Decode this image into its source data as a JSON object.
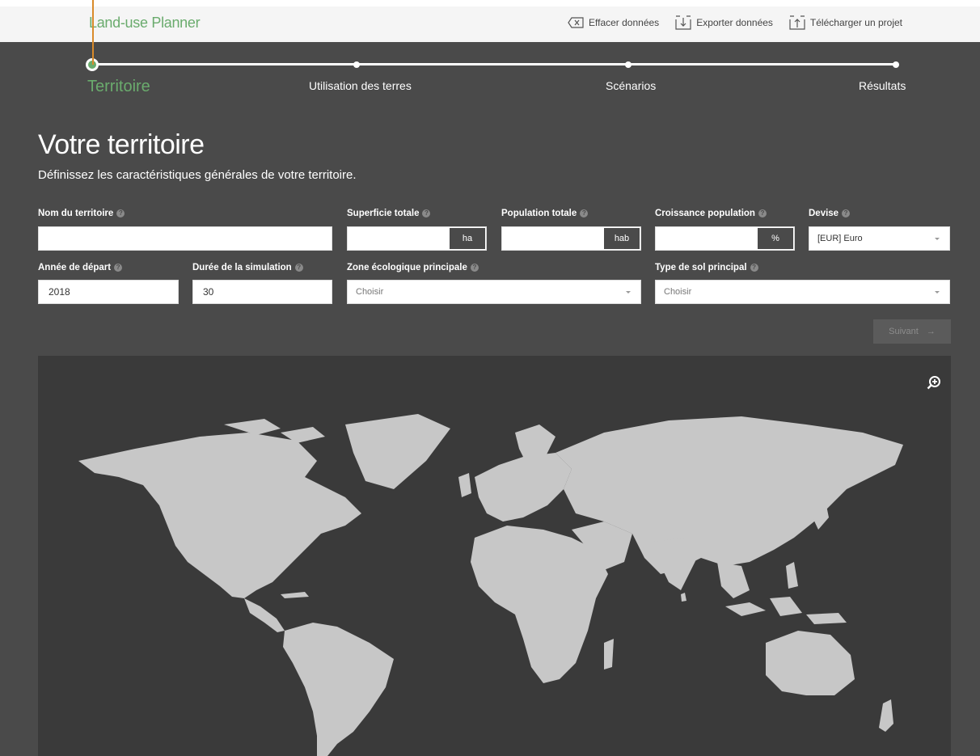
{
  "app": {
    "title": "Land-use Planner"
  },
  "toolbar": {
    "clear_label": "Effacer données",
    "export_label": "Exporter données",
    "upload_label": "Télécharger un projet"
  },
  "stepper": {
    "steps": [
      {
        "label": "Territoire",
        "active": true
      },
      {
        "label": "Utilisation des terres",
        "active": false
      },
      {
        "label": "Scénarios",
        "active": false
      },
      {
        "label": "Résultats",
        "active": false
      }
    ]
  },
  "page": {
    "title": "Votre territoire",
    "subtitle": "Définissez les caractéristiques générales de votre territoire."
  },
  "form": {
    "name": {
      "label": "Nom du territoire",
      "value": ""
    },
    "area": {
      "label": "Superficie totale",
      "value": "",
      "unit": "ha"
    },
    "population": {
      "label": "Population totale",
      "value": "",
      "unit": "hab"
    },
    "growth": {
      "label": "Croissance population",
      "value": "",
      "unit": "%"
    },
    "currency": {
      "label": "Devise",
      "value": "[EUR] Euro"
    },
    "start_year": {
      "label": "Année de départ",
      "value": "2018"
    },
    "duration": {
      "label": "Durée de la simulation",
      "value": "30"
    },
    "eco_zone": {
      "label": "Zone écologique principale",
      "value": "Choisir"
    },
    "soil_type": {
      "label": "Type de sol principal",
      "value": "Choisir"
    },
    "help_glyph": "?"
  },
  "actions": {
    "next_label": "Suivant",
    "next_arrow": "→"
  },
  "colors": {
    "accent": "#6aab6d",
    "background": "#4a4a4a",
    "map_bg": "#3a3a3a",
    "land": "#c7c7c7"
  },
  "icons": {
    "clear": "clear-data-icon",
    "export": "export-icon",
    "upload": "upload-icon",
    "zoom": "zoom-in-icon"
  }
}
